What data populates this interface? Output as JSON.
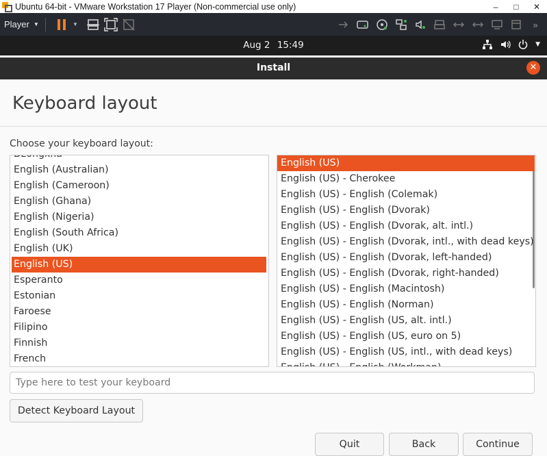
{
  "vmware": {
    "title": "Ubuntu 64-bit - VMware Workstation 17 Player (Non-commercial use only)",
    "minimize": "–",
    "maximize": "□",
    "close": "✕",
    "player_menu": "Player"
  },
  "topbar": {
    "date": "Aug 2",
    "time": "15:49"
  },
  "installer": {
    "header_title": "Install",
    "close_glyph": "✕",
    "page_title": "Keyboard layout",
    "choose_label": "Choose your keyboard layout:",
    "layouts": [
      {
        "label": "Dzongkha",
        "selected": false
      },
      {
        "label": "English (Australian)",
        "selected": false
      },
      {
        "label": "English (Cameroon)",
        "selected": false
      },
      {
        "label": "English (Ghana)",
        "selected": false
      },
      {
        "label": "English (Nigeria)",
        "selected": false
      },
      {
        "label": "English (South Africa)",
        "selected": false
      },
      {
        "label": "English (UK)",
        "selected": false
      },
      {
        "label": "English (US)",
        "selected": true
      },
      {
        "label": "Esperanto",
        "selected": false
      },
      {
        "label": "Estonian",
        "selected": false
      },
      {
        "label": "Faroese",
        "selected": false
      },
      {
        "label": "Filipino",
        "selected": false
      },
      {
        "label": "Finnish",
        "selected": false
      },
      {
        "label": "French",
        "selected": false
      }
    ],
    "variants": [
      {
        "label": "English (US)",
        "selected": true
      },
      {
        "label": "English (US) - Cherokee",
        "selected": false
      },
      {
        "label": "English (US) - English (Colemak)",
        "selected": false
      },
      {
        "label": "English (US) - English (Dvorak)",
        "selected": false
      },
      {
        "label": "English (US) - English (Dvorak, alt. intl.)",
        "selected": false
      },
      {
        "label": "English (US) - English (Dvorak, intl., with dead keys)",
        "selected": false
      },
      {
        "label": "English (US) - English (Dvorak, left-handed)",
        "selected": false
      },
      {
        "label": "English (US) - English (Dvorak, right-handed)",
        "selected": false
      },
      {
        "label": "English (US) - English (Macintosh)",
        "selected": false
      },
      {
        "label": "English (US) - English (Norman)",
        "selected": false
      },
      {
        "label": "English (US) - English (US, alt. intl.)",
        "selected": false
      },
      {
        "label": "English (US) - English (US, euro on 5)",
        "selected": false
      },
      {
        "label": "English (US) - English (US, intl., with dead keys)",
        "selected": false
      },
      {
        "label": "English (US) - English (Workman)",
        "selected": false
      }
    ],
    "test_placeholder": "Type here to test your keyboard",
    "detect_button": "Detect Keyboard Layout",
    "quit_button": "Quit",
    "back_button": "Back",
    "continue_button": "Continue"
  },
  "colors": {
    "accent": "#E95420",
    "header_bg": "#2C2C2C",
    "topbar_bg": "#1D1D1D",
    "toolbar_bg": "#262A30"
  }
}
